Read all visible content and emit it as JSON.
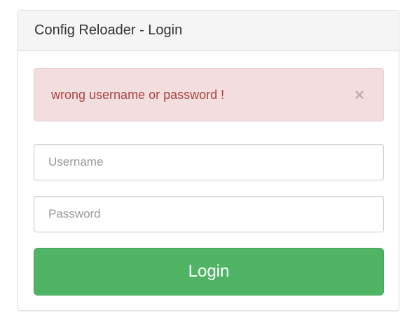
{
  "panel": {
    "title": "Config Reloader - Login"
  },
  "alert": {
    "message": "wrong username or password !",
    "close_icon": "close-icon",
    "background_color": "#f2dede",
    "text_color": "#a94442"
  },
  "form": {
    "username_placeholder": "Username",
    "username_value": "",
    "password_placeholder": "Password",
    "password_value": "",
    "login_label": "Login",
    "login_color": "#4fb464"
  }
}
